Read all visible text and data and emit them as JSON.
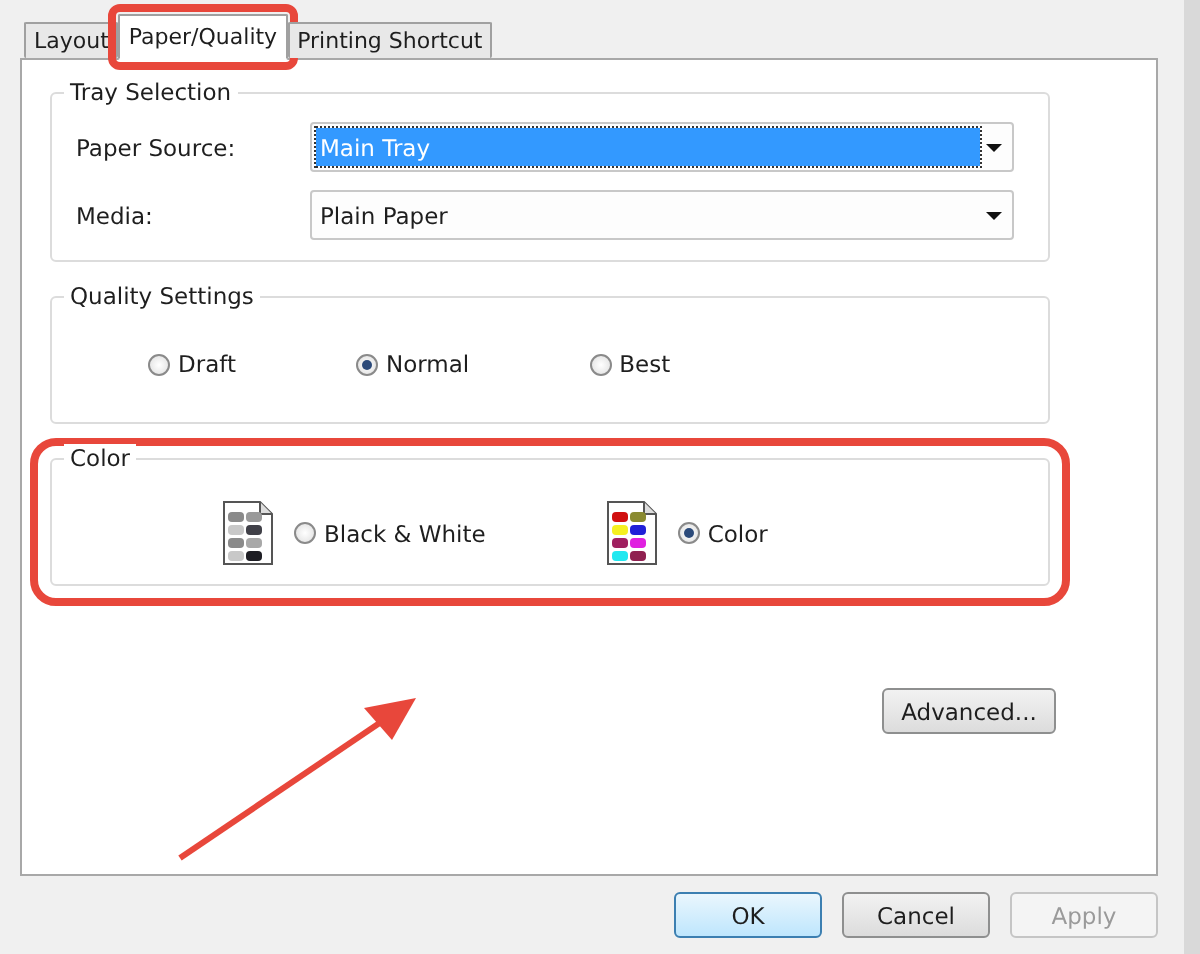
{
  "tabs": [
    {
      "label": "Layout",
      "selected": false,
      "highlighted": false
    },
    {
      "label": "Paper/Quality",
      "selected": true,
      "highlighted": true
    },
    {
      "label": "Printing Shortcut",
      "selected": false,
      "highlighted": false
    }
  ],
  "tray_selection": {
    "title": "Tray Selection",
    "fields": [
      {
        "label": "Paper Source:",
        "value": "Main Tray",
        "focused": true
      },
      {
        "label": "Media:",
        "value": "Plain Paper",
        "focused": false
      }
    ]
  },
  "quality_settings": {
    "title": "Quality Settings",
    "options": [
      {
        "label": "Draft",
        "selected": false
      },
      {
        "label": "Normal",
        "selected": true
      },
      {
        "label": "Best",
        "selected": false
      }
    ]
  },
  "color": {
    "title": "Color",
    "highlighted": true,
    "options": [
      {
        "label": "Black & White",
        "selected": false,
        "kind": "mono"
      },
      {
        "label": "Color",
        "selected": true,
        "kind": "color"
      }
    ]
  },
  "advanced_button": "Advanced...",
  "buttons": [
    {
      "label": "OK",
      "default": true,
      "disabled": false
    },
    {
      "label": "Cancel",
      "default": false,
      "disabled": false
    },
    {
      "label": "Apply",
      "default": false,
      "disabled": true
    }
  ]
}
